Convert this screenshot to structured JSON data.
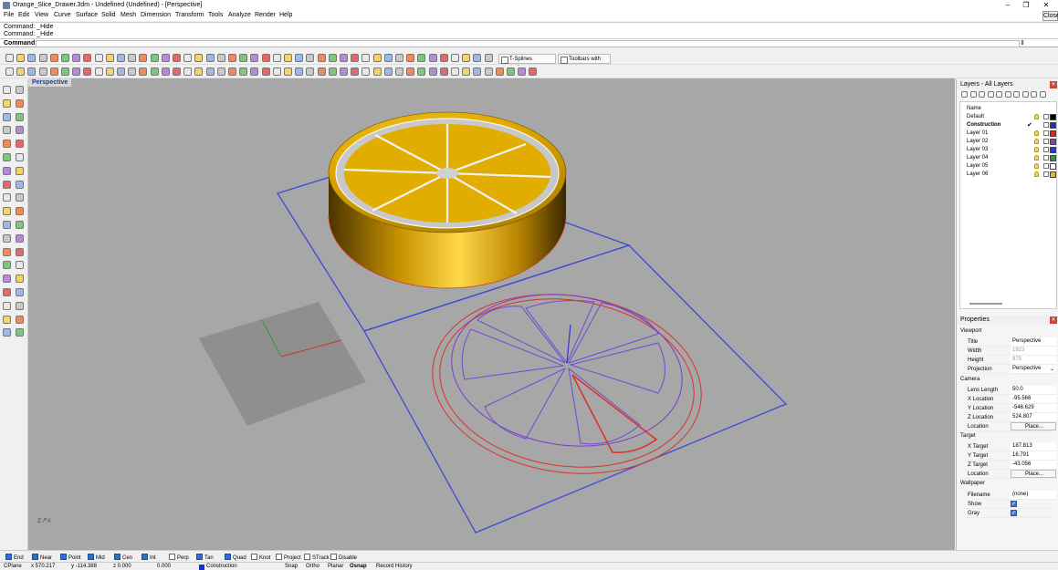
{
  "window": {
    "title": "Orange_Slice_Drawer.3dm - Undefined (Undefined) - [Perspective]",
    "minimize": "–",
    "maximize": "❐",
    "close": "✕",
    "close_label": "Close"
  },
  "menu": [
    "File",
    "Edit",
    "View",
    "Curve",
    "Surface",
    "Solid",
    "Mesh",
    "Dimension",
    "Transform",
    "Tools",
    "Analyze",
    "Render",
    "Help"
  ],
  "command": {
    "history": [
      "Command: _Hide",
      "Command: _Hide"
    ],
    "prompt": "Command:",
    "value": ""
  },
  "toolbars": {
    "tsplines_label": "T-Splines toolbars",
    "toolbars_with_text_label": "Toolbars with text"
  },
  "viewport": {
    "tab": "Perspective",
    "axis_label": "z↗x"
  },
  "layers_panel": {
    "title": "Layers - All Layers",
    "column_name": "Name",
    "layers": [
      {
        "name": "Default",
        "color": "#000000",
        "current": false
      },
      {
        "name": "Construction",
        "color": "#1a2fd0",
        "current": true
      },
      {
        "name": "Layer 01",
        "color": "#e02020",
        "current": false
      },
      {
        "name": "Layer 02",
        "color": "#8a3cc8",
        "current": false
      },
      {
        "name": "Layer 03",
        "color": "#1c3cdc",
        "current": false
      },
      {
        "name": "Layer 04",
        "color": "#2a9a3a",
        "current": false
      },
      {
        "name": "Layer 05",
        "color": "#ffffff",
        "current": false
      },
      {
        "name": "Layer 06",
        "color": "#e8c000",
        "current": false
      }
    ],
    "check_mark": "✔"
  },
  "properties_panel": {
    "title": "Properties",
    "viewport_section": "Viewport",
    "viewport": [
      {
        "key": "Title",
        "value": "Perspective",
        "disabled": false
      },
      {
        "key": "Width",
        "value": "1923",
        "disabled": true
      },
      {
        "key": "Height",
        "value": "975",
        "disabled": true
      },
      {
        "key": "Projection",
        "value": "Perspective",
        "disabled": false
      }
    ],
    "camera_section": "Camera",
    "camera": [
      {
        "key": "Lens Length",
        "value": "50.0"
      },
      {
        "key": "X Location",
        "value": "-95.566"
      },
      {
        "key": "Y Location",
        "value": "-546.629"
      },
      {
        "key": "Z Location",
        "value": "524.807"
      },
      {
        "key": "Location",
        "value": "Place..."
      }
    ],
    "target_section": "Target",
    "target": [
      {
        "key": "X Target",
        "value": "187.813"
      },
      {
        "key": "Y Target",
        "value": "16.791"
      },
      {
        "key": "Z Target",
        "value": "-43.056"
      },
      {
        "key": "Location",
        "value": "Place..."
      }
    ],
    "wallpaper_section": "Wallpaper",
    "wallpaper": {
      "filename_label": "Filename",
      "filename_value": "(none)",
      "show_label": "Show",
      "gray_label": "Gray",
      "check": "✓"
    }
  },
  "osnap": [
    {
      "label": "End",
      "on": true
    },
    {
      "label": "Near",
      "on": true
    },
    {
      "label": "Point",
      "on": true
    },
    {
      "label": "Mid",
      "on": true
    },
    {
      "label": "Cen",
      "on": true
    },
    {
      "label": "Int",
      "on": true
    },
    {
      "label": "Perp",
      "on": false
    },
    {
      "label": "Tan",
      "on": true
    },
    {
      "label": "Quad",
      "on": true
    },
    {
      "label": "Knot",
      "on": false
    },
    {
      "label": "Project",
      "on": false
    },
    {
      "label": "STrack",
      "on": false
    },
    {
      "label": "Disable",
      "on": false
    }
  ],
  "status": {
    "cplane": "CPlane",
    "x": "x 570.217",
    "y": "y -114.388",
    "z": "z 0.000",
    "distance": "0.000",
    "layer": "Construction",
    "layer_color": "#1a2fd0",
    "snap": "Snap",
    "ortho": "Ortho",
    "planar": "Planar",
    "osnap": "Osnap",
    "record": "Record History"
  },
  "colors": {
    "viewport_bg": "#a7a7a7",
    "gold": "#d9a800",
    "curve_red": "#d8342a",
    "curve_blue": "#3b4bd6"
  }
}
